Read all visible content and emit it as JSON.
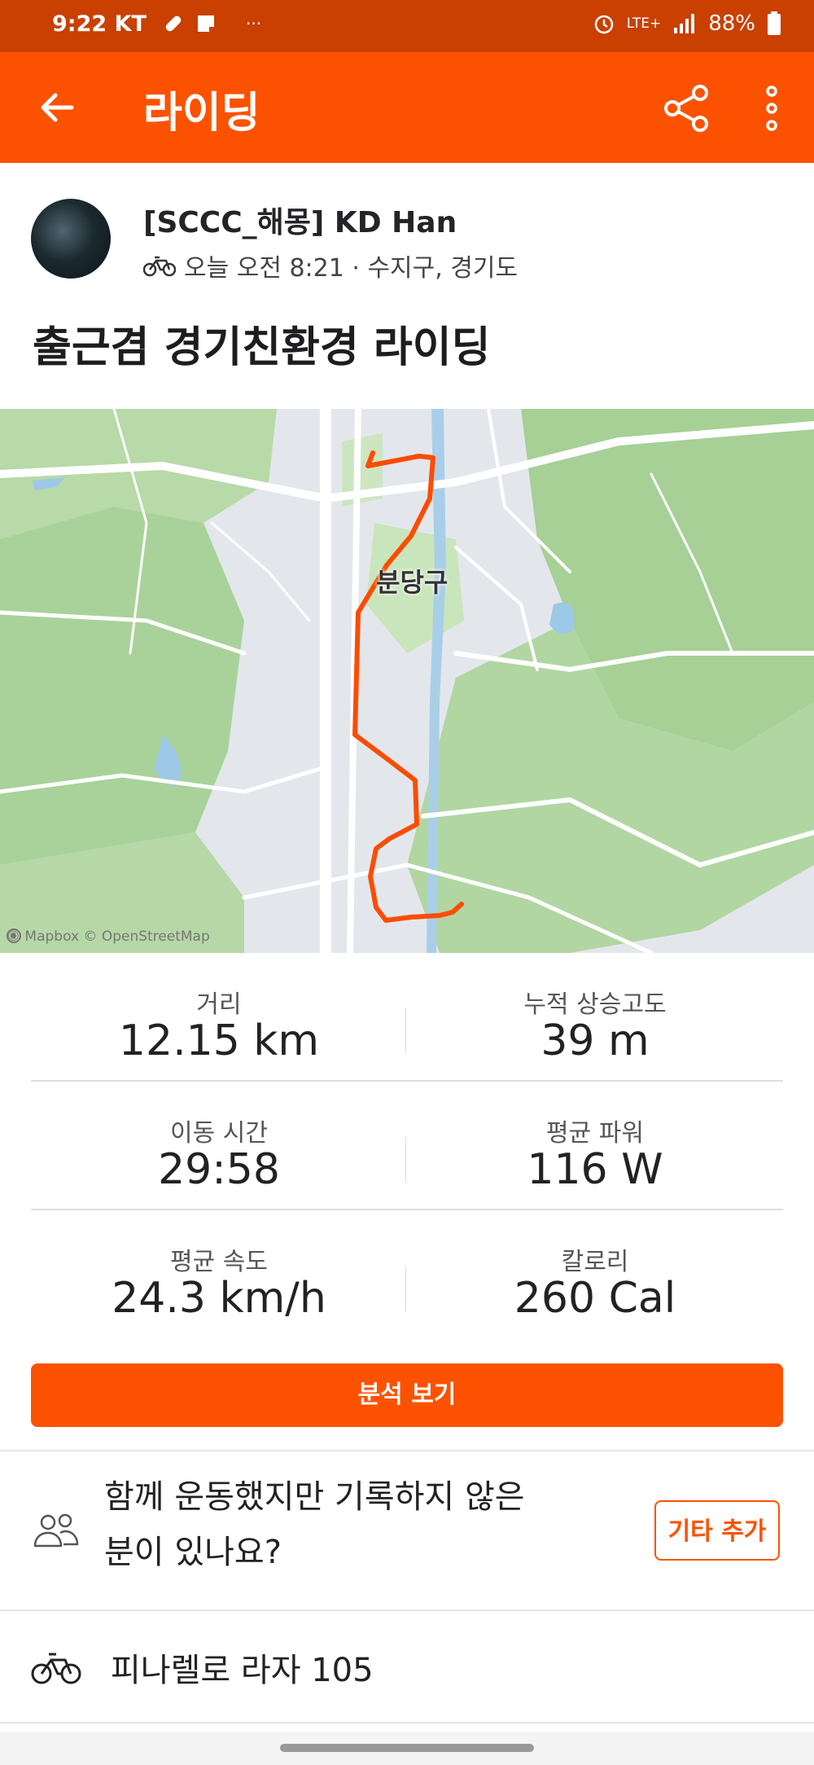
{
  "status_bar": {
    "time": "9:22",
    "carrier": "KT",
    "network": "LTE+",
    "battery": "88%",
    "dots": "···"
  },
  "app_bar": {
    "title": "라이딩"
  },
  "activity": {
    "athlete_name": "[SCCC_해몽] KD Han",
    "meta": "오늘 오전 8:21 · 수지구, 경기도",
    "title": "출근겸 경기친환경 라이딩"
  },
  "map": {
    "place_label": "분당구",
    "attribution": "© Mapbox © OpenStreetMap",
    "route_color": "#fc4c02"
  },
  "stats": [
    {
      "label": "거리",
      "value": "12.15 km"
    },
    {
      "label": "누적 상승고도",
      "value": "39 m"
    },
    {
      "label": "이동 시간",
      "value": "29:58"
    },
    {
      "label": "평균 파워",
      "value": "116 W"
    },
    {
      "label": "평균 속도",
      "value": "24.3 km/h"
    },
    {
      "label": "칼로리",
      "value": "260 Cal"
    }
  ],
  "analyze_button": "분석 보기",
  "together": {
    "line1": "함께 운동했지만 기록하지 않은",
    "line2": "분이 있나요?",
    "button": "기타 추가"
  },
  "gear": {
    "bike": "피나렐로 라자 105"
  },
  "colors": {
    "brand": "#fc5200",
    "status_bar": "#c94000"
  }
}
